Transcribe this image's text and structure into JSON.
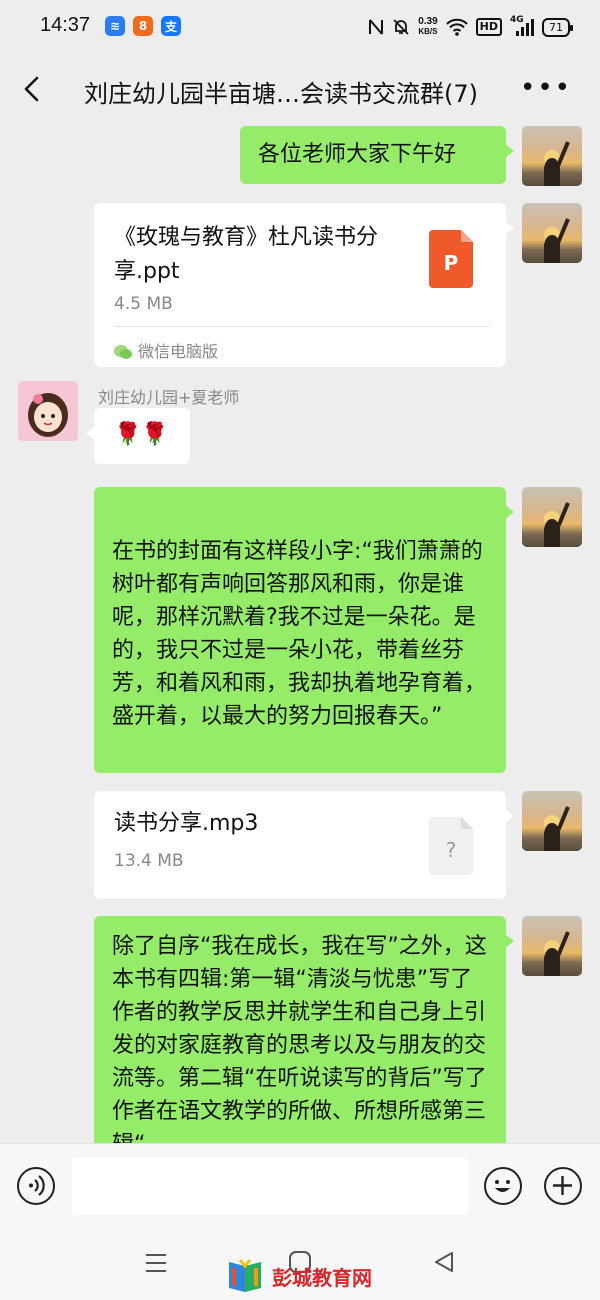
{
  "status": {
    "time": "14:37",
    "net_speed_value": "0.39",
    "net_speed_unit": "KB/S",
    "hd": "HD",
    "signal": "4G",
    "battery": "71"
  },
  "header": {
    "title": "刘庄幼儿园半亩塘…会读书交流群(7)"
  },
  "messages": {
    "m1": {
      "text": "各位老师大家下午好"
    },
    "m2": {
      "file_name": "《玫瑰与教育》杜凡读书分享.ppt",
      "size": "4.5 MB",
      "source": "微信电脑版",
      "icon_letter": "P"
    },
    "m3": {
      "sender": "刘庄幼儿园+夏老师",
      "text": "🌹🌹"
    },
    "m4": {
      "text": "在书的封面有这样段小字:“我们萧萧的树叶都有声响回答那风和雨，你是谁呢，那样沉默着?我不过是一朵花。是的，我只不过是一朵小花，带着丝芬芳，和着风和雨，我却执着地孕育着，盛开着，以最大的努力回报春天。”"
    },
    "m5": {
      "file_name": "读书分享.mp3",
      "size": "13.4 MB",
      "icon_letter": "?"
    },
    "m6": {
      "text": "除了自序“我在成长，我在写”之外，这本书有四辑:第一辑“清淡与忧患”写了作者的教学反思并就学生和自己身上引发的对家庭教育的思考以及与朋友的交流等。第二辑“在听说读写的背后”写了作者在语文教学的所做、所想所感第三辑“"
    }
  },
  "watermark": {
    "text": "彭城教育网"
  },
  "colors": {
    "bubble_green": "#95ec69",
    "ppt_orange": "#f05a2a",
    "bg": "#ededed"
  }
}
